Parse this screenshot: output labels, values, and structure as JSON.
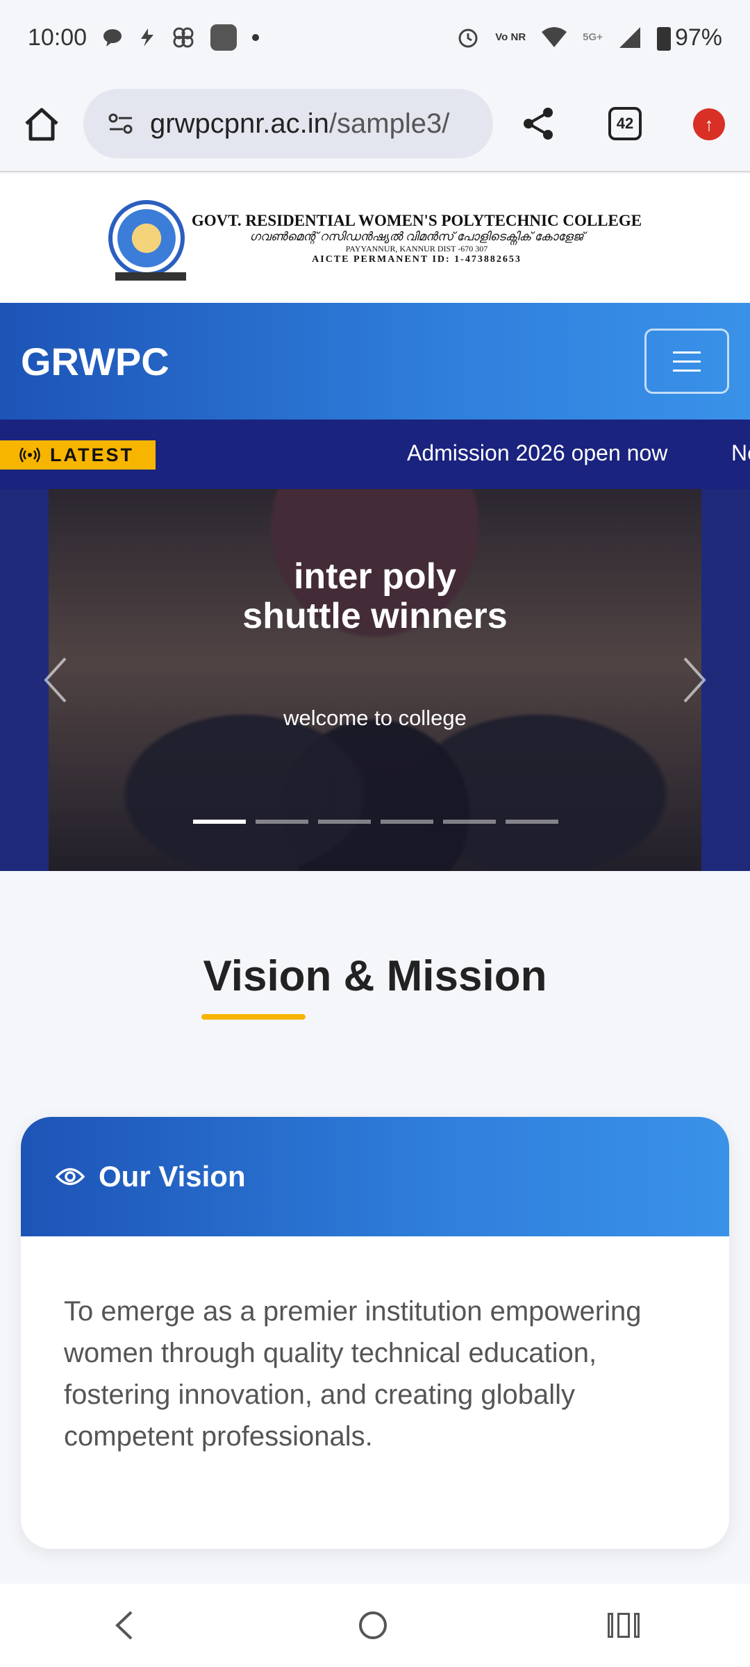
{
  "status_bar": {
    "time": "10:00",
    "signal_tag": "5G+",
    "volte_tag": "Vo NR",
    "battery": "97%"
  },
  "browser": {
    "url_domain": "grwpcpnr.ac.in",
    "url_path": "/sample3/",
    "tab_count": "42"
  },
  "logo": {
    "line1": "GOVT. RESIDENTIAL WOMEN'S POLYTECHNIC COLLEGE",
    "line2": "ഗവൺമെന്റ് റസിഡൻഷ്യൽ വിമൻസ് പോളിടെക്നിക് കോളേജ്",
    "line3": "PAYYANNUR, KANNUR DIST -670 307",
    "line4": "AICTE PERMANENT ID: 1-473882653"
  },
  "header": {
    "brand": "GRWPC"
  },
  "ticker": {
    "badge": "LATEST",
    "text": "Admission 2026 open now",
    "next_text": "Ne"
  },
  "carousel": {
    "title": "inter poly shuttle winners",
    "subtitle": "welcome to college",
    "slide_count": 6,
    "active_index": 0
  },
  "vision_section": {
    "title": "Vision & Mission",
    "card_title": "Our Vision",
    "card_body": "To emerge as a premier institution empowering women through quality technical education, fostering innovation, and creating globally competent professionals."
  },
  "colors": {
    "primary_blue": "#1d54b6",
    "accent_blue": "#3a92e8",
    "ticker_bg": "#1a237e",
    "accent_yellow": "#f7b500"
  }
}
